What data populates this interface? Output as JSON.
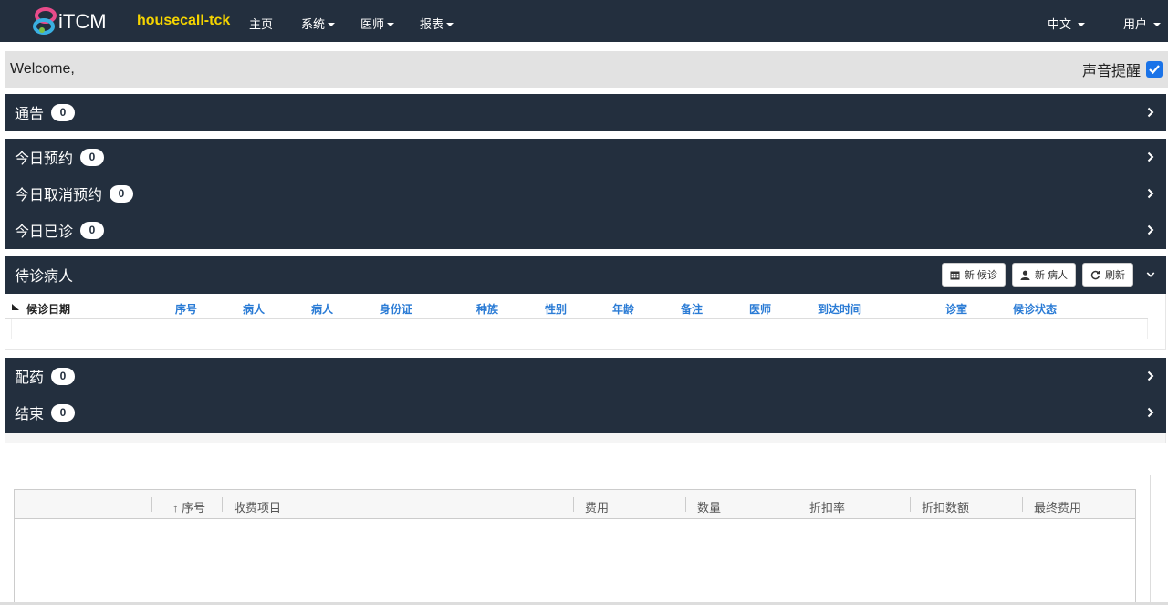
{
  "navbar": {
    "logo_text": "iTCM",
    "brand": "housecall-tck",
    "home": "主页",
    "system": "系统",
    "doctor": "医师",
    "report": "报表",
    "language": "中文",
    "user": "用户",
    "brand_color": "#f5d400",
    "bg_color": "#232f3e"
  },
  "welcome": {
    "text": "Welcome,",
    "sound_label": "声音提醒",
    "sound_checked": true
  },
  "panels": {
    "notice": {
      "label": "通告",
      "count": "0"
    },
    "today_appt": {
      "label": "今日预约",
      "count": "0"
    },
    "today_cancel": {
      "label": "今日取消预约",
      "count": "0"
    },
    "today_done": {
      "label": "今日已诊",
      "count": "0"
    },
    "waiting": {
      "label": "待诊病人",
      "btn_new_wait": "新 候诊",
      "btn_new_patient": "新 病人",
      "btn_refresh": "刷新"
    },
    "dispense": {
      "label": "配药",
      "count": "0"
    },
    "finish": {
      "label": "结束",
      "count": "0"
    }
  },
  "waiting_table": {
    "columns": [
      "候诊日期",
      "序号",
      "病人",
      "病人",
      "身份证",
      "种族",
      "性别",
      "年龄",
      "备注",
      "医师",
      "到达时间",
      "诊室",
      "候诊状态"
    ]
  },
  "fee_table": {
    "columns": [
      "↑ 序号",
      "收费项目",
      "费用",
      "数量",
      "折扣率",
      "折扣数额",
      "最终费用"
    ]
  }
}
